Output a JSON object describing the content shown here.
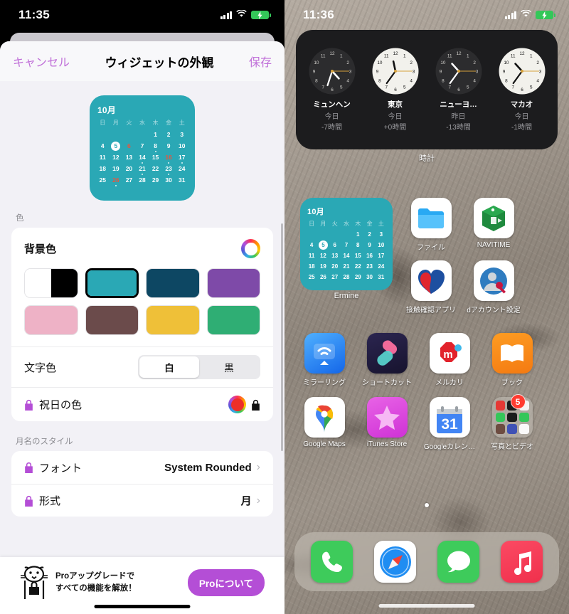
{
  "left_phone": {
    "status_bar": {
      "time": "11:35",
      "signal_icon": "cellular-bars-icon",
      "wifi_icon": "wifi-icon",
      "battery_icon": "battery-charging-icon"
    },
    "navbar": {
      "cancel_label": "キャンセル",
      "title": "ウィジェットの外観",
      "save_label": "保存",
      "accent_color": "#c06fd8"
    },
    "preview": {
      "month_label": "10月",
      "weekdays": [
        "日",
        "月",
        "火",
        "水",
        "木",
        "金",
        "土"
      ],
      "background_color": "#2aa8b5",
      "text_color": "#ffffff",
      "holiday_color": "#e8563d",
      "today": 5,
      "holidays": [
        6,
        16,
        26
      ],
      "event_dots": [
        8,
        14,
        16,
        17,
        21,
        23,
        26
      ],
      "leading_blanks": 4,
      "days": [
        1,
        2,
        3,
        4,
        5,
        6,
        7,
        8,
        9,
        10,
        11,
        12,
        13,
        14,
        15,
        16,
        17,
        18,
        19,
        20,
        21,
        22,
        23,
        24,
        25,
        26,
        27,
        28,
        29,
        30,
        31
      ]
    },
    "color_section": {
      "section_label": "色",
      "bg_title": "背景色",
      "color_wheel_icon": "color-wheel-icon",
      "swatches": [
        {
          "name": "white-black",
          "split": true,
          "colors": [
            "#ffffff",
            "#000000"
          ],
          "selected": false
        },
        {
          "name": "teal",
          "colors": [
            "#2aa8b5"
          ],
          "selected": true
        },
        {
          "name": "navy",
          "colors": [
            "#0d4763"
          ],
          "selected": false
        },
        {
          "name": "purple",
          "colors": [
            "#7e4aa8"
          ],
          "selected": false
        },
        {
          "name": "pink",
          "colors": [
            "#eeb2c6"
          ],
          "selected": false
        },
        {
          "name": "brown",
          "colors": [
            "#6b4b4b"
          ],
          "selected": false
        },
        {
          "name": "gold",
          "colors": [
            "#efc038"
          ],
          "selected": false
        },
        {
          "name": "green",
          "colors": [
            "#2fae74"
          ],
          "selected": false
        }
      ],
      "text_color_row": {
        "label": "文字色",
        "options": [
          "白",
          "黒"
        ],
        "selected": "白"
      },
      "holiday_row": {
        "label": "祝日の色",
        "lock_icon": "lock-icon",
        "swatch_color": "#ed2f29",
        "trailing_lock_icon": "lock-icon"
      }
    },
    "style_section": {
      "section_label": "月名のスタイル",
      "rows": [
        {
          "label": "フォント",
          "value": "System Rounded",
          "lock_icon": "lock-icon",
          "chevron": "›"
        },
        {
          "label": "形式",
          "value": "月",
          "lock_icon": "lock-icon",
          "chevron": "›"
        }
      ]
    },
    "promo": {
      "mascot_icon": "bear-with-lock-icon",
      "line1": "Proアップグレードで",
      "line2": "すべての機能を解放！",
      "button_label": "Proについて",
      "button_color": "#b44ed6"
    }
  },
  "right_phone": {
    "status_bar": {
      "time": "11:36",
      "signal_icon": "cellular-bars-icon",
      "wifi_icon": "wifi-icon",
      "battery_icon": "battery-charging-icon"
    },
    "clock_widget": {
      "label": "時計",
      "clocks": [
        {
          "city": "ミュンヘン",
          "day": "今日",
          "offset": "-7時間",
          "theme": "dark",
          "hour": 4.6,
          "minute": 33
        },
        {
          "city": "東京",
          "day": "今日",
          "offset": "+0時間",
          "theme": "light",
          "hour": 11.6,
          "minute": 36
        },
        {
          "city": "ニューヨ…",
          "day": "昨日",
          "offset": "-13時間",
          "theme": "dark",
          "hour": 10.6,
          "minute": 36
        },
        {
          "city": "マカオ",
          "day": "今日",
          "offset": "-1時間",
          "theme": "light",
          "hour": 10.6,
          "minute": 36
        }
      ]
    },
    "calendar_widget": {
      "label": "Ermine",
      "month_label": "10月",
      "weekdays": [
        "日",
        "月",
        "火",
        "水",
        "木",
        "金",
        "土"
      ],
      "background_color": "#2aa8b5",
      "today": 5,
      "leading_blanks": 4,
      "days": [
        1,
        2,
        3,
        4,
        5,
        6,
        7,
        8,
        9,
        10,
        11,
        12,
        13,
        14,
        15,
        16,
        17,
        18,
        19,
        20,
        21,
        22,
        23,
        24,
        25,
        26,
        27,
        28,
        29,
        30,
        31
      ]
    },
    "apps": [
      [
        {
          "name": "ファイル",
          "icon": "files-icon"
        },
        {
          "name": "NAVITIME",
          "icon": "navitime-icon"
        }
      ],
      [
        {
          "name": "接触確認アプリ",
          "icon": "cocoa-contact-icon"
        },
        {
          "name": "dアカウント設定",
          "icon": "d-account-icon"
        }
      ],
      [
        {
          "name": "ミラーリング",
          "icon": "mirroring-icon"
        },
        {
          "name": "ショートカット",
          "icon": "shortcuts-icon"
        },
        {
          "name": "メルカリ",
          "icon": "mercari-icon"
        },
        {
          "name": "ブック",
          "icon": "books-icon"
        }
      ],
      [
        {
          "name": "Google Maps",
          "icon": "google-maps-icon"
        },
        {
          "name": "iTunes Store",
          "icon": "itunes-store-icon"
        },
        {
          "name": "Googleカレン…",
          "icon": "google-calendar-icon",
          "glyph": "31"
        },
        {
          "name": "写真とビデオ",
          "icon": "folder-icon",
          "badge": "5"
        }
      ]
    ],
    "page_dots": {
      "count": 1,
      "active": 0
    },
    "dock": [
      {
        "name": "電話",
        "icon": "phone-icon"
      },
      {
        "name": "Safari",
        "icon": "safari-icon"
      },
      {
        "name": "メッセージ",
        "icon": "messages-icon"
      },
      {
        "name": "ミュージック",
        "icon": "music-icon"
      }
    ]
  }
}
